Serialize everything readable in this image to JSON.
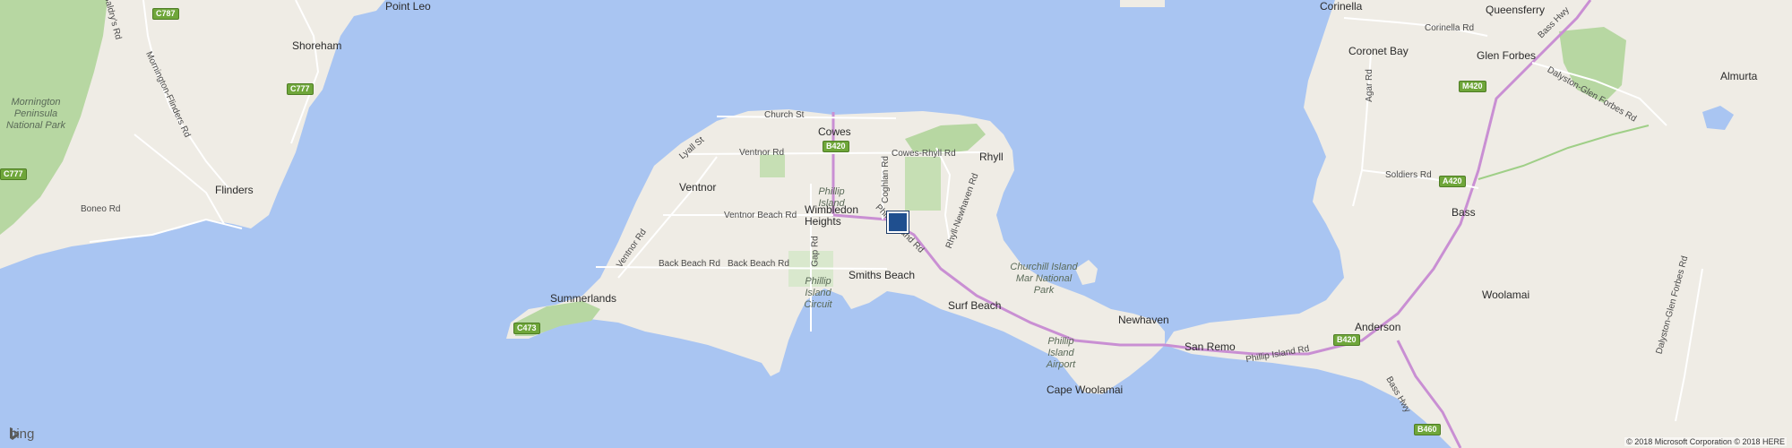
{
  "map": {
    "colors": {
      "water": "#a9c5f2",
      "land": "#efece5",
      "park": "#b7d7a2",
      "major_road": "#c98fd3",
      "minor_road": "#ffffff"
    },
    "marker": {
      "name": "location-marker",
      "color": "#1f4f8f"
    },
    "towns": [
      {
        "key": "point-leo",
        "text": "Point Leo"
      },
      {
        "key": "shoreham",
        "text": "Shoreham"
      },
      {
        "key": "flinders",
        "text": "Flinders"
      },
      {
        "key": "cowes",
        "text": "Cowes"
      },
      {
        "key": "ventnor",
        "text": "Ventnor"
      },
      {
        "key": "wimbledon-heights",
        "text": "Wimbledon Heights"
      },
      {
        "key": "rhyll",
        "text": "Rhyll"
      },
      {
        "key": "smiths-beach",
        "text": "Smiths Beach"
      },
      {
        "key": "summerlands",
        "text": "Summerlands"
      },
      {
        "key": "surf-beach",
        "text": "Surf Beach"
      },
      {
        "key": "newhaven",
        "text": "Newhaven"
      },
      {
        "key": "san-remo",
        "text": "San Remo"
      },
      {
        "key": "cape-woolamai",
        "text": "Cape Woolamai"
      },
      {
        "key": "coronet-bay",
        "text": "Coronet Bay"
      },
      {
        "key": "corinella",
        "text": "Corinella"
      },
      {
        "key": "queensferry",
        "text": "Queensferry"
      },
      {
        "key": "glen-forbes",
        "text": "Glen Forbes"
      },
      {
        "key": "almurta",
        "text": "Almurta"
      },
      {
        "key": "bass",
        "text": "Bass"
      },
      {
        "key": "woolamai",
        "text": "Woolamai"
      },
      {
        "key": "anderson",
        "text": "Anderson"
      }
    ],
    "roads": [
      {
        "key": "church-st",
        "text": "Church St"
      },
      {
        "key": "ventnor-rd",
        "text": "Ventnor Rd"
      },
      {
        "key": "lyall-st",
        "text": "Lyall St"
      },
      {
        "key": "cowes-rhyll-rd",
        "text": "Cowes-Rhyll Rd"
      },
      {
        "key": "coghlan-rd",
        "text": "Coghlan Rd"
      },
      {
        "key": "ventnor-beach-rd",
        "text": "Ventnor Beach Rd"
      },
      {
        "key": "phillip-island-rd-west",
        "text": "Phillip Island Rd"
      },
      {
        "key": "rhyll-newhaven-rd",
        "text": "Rhyll-Newhaven Rd"
      },
      {
        "key": "gap-rd",
        "text": "Gap Rd"
      },
      {
        "key": "back-beach-rd-1",
        "text": "Back Beach Rd"
      },
      {
        "key": "back-beach-rd-2",
        "text": "Back Beach Rd"
      },
      {
        "key": "ventnor-rd-diag",
        "text": "Ventnor Rd"
      },
      {
        "key": "boneo-rd",
        "text": "Boneo Rd"
      },
      {
        "key": "mornington-flinders-rd",
        "text": "Mornington-Flinders Rd"
      },
      {
        "key": "baldrys-rd",
        "text": "Baldry's Rd"
      },
      {
        "key": "phillip-island-rd-east",
        "text": "Phillip Island Rd"
      },
      {
        "key": "corinella-rd",
        "text": "Corinella Rd"
      },
      {
        "key": "bass-hwy-north",
        "text": "Bass Hwy"
      },
      {
        "key": "bass-hwy-south",
        "text": "Bass Hwy"
      },
      {
        "key": "agar-rd",
        "text": "Agar Rd"
      },
      {
        "key": "soldiers-rd",
        "text": "Soldiers Rd"
      },
      {
        "key": "dalyston-glen-forbes-rd-1",
        "text": "Dalyston-Glen Forbes Rd"
      },
      {
        "key": "dalyston-glen-forbes-rd-2",
        "text": "Dalyston-Glen Forbes Rd"
      }
    ],
    "parks": [
      {
        "key": "mornington-np",
        "text": "Mornington Peninsula National Park"
      },
      {
        "key": "phillip-island",
        "text": "Phillip Island"
      },
      {
        "key": "phillip-island-circuit",
        "text": "Phillip Island Circuit"
      },
      {
        "key": "churchill-island",
        "text": "Churchill Island Mar National Park"
      },
      {
        "key": "phillip-island-airport",
        "text": "Phillip Island Airport"
      }
    ],
    "shields": [
      {
        "key": "c787",
        "text": "C787"
      },
      {
        "key": "c777",
        "text": "C777"
      },
      {
        "key": "c777-west",
        "text": "C777"
      },
      {
        "key": "b420-cowes",
        "text": "B420"
      },
      {
        "key": "c473",
        "text": "C473"
      },
      {
        "key": "m420",
        "text": "M420"
      },
      {
        "key": "a420",
        "text": "A420"
      },
      {
        "key": "b420-east",
        "text": "B420"
      },
      {
        "key": "b460",
        "text": "B460"
      }
    ]
  },
  "attribution": {
    "logo": "bing",
    "copyright": "© 2018 Microsoft Corporation © 2018 HERE"
  }
}
